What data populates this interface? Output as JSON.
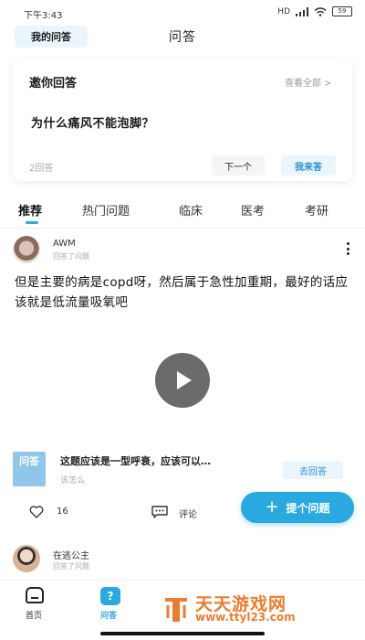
{
  "status_bar": {
    "time": "下午3:43",
    "battery": "59",
    "network": "HD"
  },
  "header": {
    "my_qa_label": "我的问答",
    "title": "问答"
  },
  "invite": {
    "title": "邀你回答",
    "view_all": "查看全部 >",
    "question": "为什么痛风不能泡脚？",
    "answer_count": "2回答",
    "next_label": "下一个",
    "answer_label": "我来答"
  },
  "tabs": [
    {
      "label": "推荐",
      "active": true
    },
    {
      "label": "热门问题",
      "active": false
    },
    {
      "label": "临床",
      "active": false
    },
    {
      "label": "医考",
      "active": false
    },
    {
      "label": "考研",
      "active": false
    }
  ],
  "post": {
    "username": "AWM",
    "meta": "回答了问题",
    "text": "但是主要的病是copd呀，然后属于急性加重期，最好的话应该就是低流量吸氧吧",
    "like_count": "16",
    "comment_label": "评论"
  },
  "related": {
    "icon_text": "问答",
    "question": "这题应该是一型呼衰，应该可以…",
    "sub": "该怎么",
    "go_answer_label": "去回答"
  },
  "ask_button": {
    "label": "提个问题"
  },
  "post2": {
    "username": "在逃公主",
    "meta": "回答了问题"
  },
  "bottom_nav": {
    "home_label": "首页",
    "qa_label": "问答",
    "qa_icon_glyph": "?"
  },
  "watermark": {
    "title": "天天游戏网",
    "url": "www.ttyl23.com"
  },
  "colors": {
    "accent": "#2aa9e0",
    "light_accent_bg": "#eaf6fc",
    "watermark": "#ea7d2f"
  }
}
